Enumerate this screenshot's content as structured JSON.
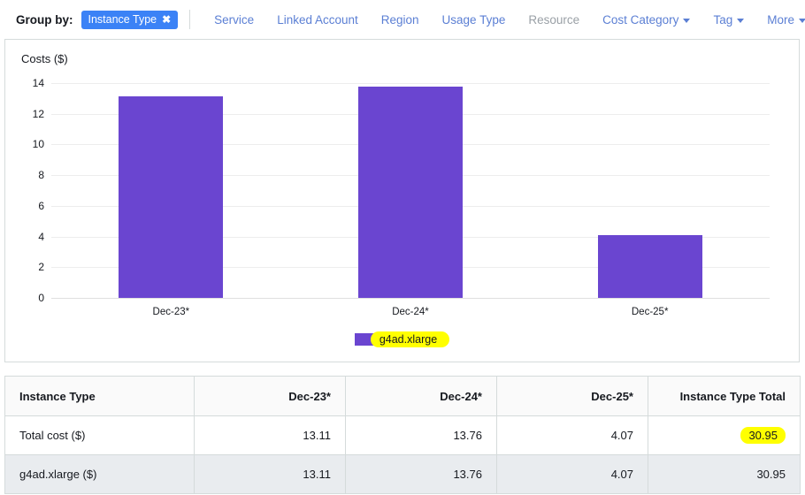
{
  "group_by": {
    "label": "Group by:",
    "selected_pill": {
      "label": "Instance Type",
      "remove_icon": "✖"
    },
    "options": [
      {
        "label": "Service",
        "disabled": false,
        "has_caret": false
      },
      {
        "label": "Linked Account",
        "disabled": false,
        "has_caret": false
      },
      {
        "label": "Region",
        "disabled": false,
        "has_caret": false
      },
      {
        "label": "Usage Type",
        "disabled": false,
        "has_caret": false
      },
      {
        "label": "Resource",
        "disabled": true,
        "has_caret": false
      },
      {
        "label": "Cost Category",
        "disabled": false,
        "has_caret": true
      },
      {
        "label": "Tag",
        "disabled": false,
        "has_caret": true
      },
      {
        "label": "More",
        "disabled": false,
        "has_caret": true
      }
    ]
  },
  "chart_data": {
    "type": "bar",
    "title": "Costs ($)",
    "xlabel": "",
    "ylabel": "Costs ($)",
    "categories": [
      "Dec-23*",
      "Dec-24*",
      "Dec-25*"
    ],
    "series": [
      {
        "name": "g4ad.xlarge",
        "color": "#6a45d0",
        "values": [
          13.11,
          13.76,
          4.07
        ]
      }
    ],
    "ylim": [
      0,
      14
    ],
    "yticks": [
      0,
      2,
      4,
      6,
      8,
      10,
      12,
      14
    ],
    "ytick_labels": [
      "0",
      "2",
      "4",
      "6",
      "8",
      "10",
      "12",
      "14"
    ],
    "grid": true,
    "legend_position": "bottom",
    "legend_highlighted": true,
    "highlight_color": "#ffff00"
  },
  "table": {
    "columns": [
      "Instance Type",
      "Dec-23*",
      "Dec-24*",
      "Dec-25*",
      "Instance Type Total"
    ],
    "rows": [
      {
        "name": "Total cost ($)",
        "values": [
          "13.11",
          "13.76",
          "4.07"
        ],
        "total": "30.95",
        "total_highlighted": true
      },
      {
        "name": "g4ad.xlarge ($)",
        "values": [
          "13.11",
          "13.76",
          "4.07"
        ],
        "total": "30.95",
        "total_highlighted": false
      }
    ]
  }
}
